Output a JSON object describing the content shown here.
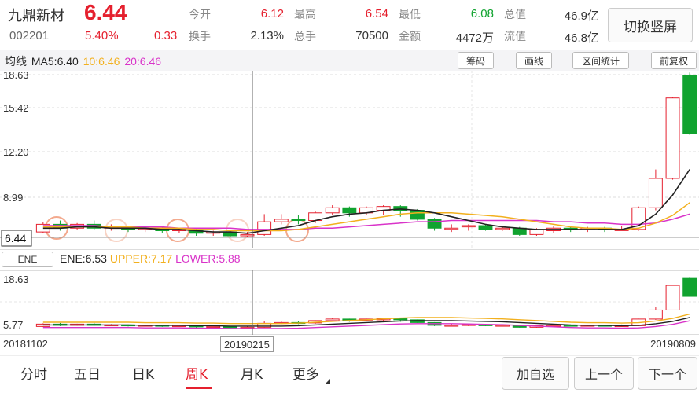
{
  "header": {
    "name": "九鼎新材",
    "price": "6.44",
    "code": "002201",
    "pct": "5.40%",
    "change": "0.33",
    "switch_label": "切换竖屏",
    "quotes": [
      {
        "label": "今开",
        "value": "6.12",
        "color": "red"
      },
      {
        "label": "最高",
        "value": "6.54",
        "color": "red"
      },
      {
        "label": "最低",
        "value": "6.08",
        "color": "green"
      },
      {
        "label": "总值",
        "value": "46.9亿",
        "color": "dark"
      },
      {
        "label": "换手",
        "value": "2.13%",
        "color": "dark"
      },
      {
        "label": "总手",
        "value": "70500",
        "color": "dark"
      },
      {
        "label": "金额",
        "value": "4472万",
        "color": "dark"
      },
      {
        "label": "流值",
        "value": "46.8亿",
        "color": "dark"
      }
    ]
  },
  "ma": {
    "label": "均线",
    "ma5": "MA5:6.40",
    "ma10": "10:6.46",
    "ma20": "20:6.46"
  },
  "tools": {
    "chips": "筹码",
    "draw": "画线",
    "range": "区间统计",
    "fq": "前复权"
  },
  "chart_data": {
    "type": "candlestick",
    "y_ticks": [
      "18.63",
      "15.42",
      "12.20",
      "8.99"
    ],
    "current_price_label": "6.44",
    "ylim": [
      5.77,
      18.63
    ],
    "candles": [
      {
        "o": 6.3,
        "c": 6.9,
        "h": 7.1,
        "l": 6.2
      },
      {
        "o": 6.9,
        "c": 6.6,
        "h": 7.2,
        "l": 6.4
      },
      {
        "o": 6.6,
        "c": 6.9,
        "h": 7.0,
        "l": 6.5
      },
      {
        "o": 6.9,
        "c": 6.6,
        "h": 7.2,
        "l": 6.5
      },
      {
        "o": 6.6,
        "c": 6.7,
        "h": 6.9,
        "l": 6.4
      },
      {
        "o": 6.7,
        "c": 6.5,
        "h": 6.8,
        "l": 6.3
      },
      {
        "o": 6.5,
        "c": 6.6,
        "h": 6.7,
        "l": 6.3
      },
      {
        "o": 6.6,
        "c": 6.4,
        "h": 6.7,
        "l": 6.2
      },
      {
        "o": 6.4,
        "c": 6.5,
        "h": 6.6,
        "l": 6.2
      },
      {
        "o": 6.5,
        "c": 6.2,
        "h": 6.6,
        "l": 6.0
      },
      {
        "o": 6.2,
        "c": 6.3,
        "h": 6.4,
        "l": 6.0
      },
      {
        "o": 6.3,
        "c": 6.0,
        "h": 6.4,
        "l": 5.9
      },
      {
        "o": 6.0,
        "c": 6.1,
        "h": 6.3,
        "l": 5.9
      },
      {
        "o": 6.1,
        "c": 7.1,
        "h": 7.7,
        "l": 6.0
      },
      {
        "o": 7.1,
        "c": 7.3,
        "h": 7.7,
        "l": 6.9
      },
      {
        "o": 7.3,
        "c": 7.2,
        "h": 7.6,
        "l": 6.9
      },
      {
        "o": 7.2,
        "c": 7.8,
        "h": 7.9,
        "l": 7.0
      },
      {
        "o": 7.8,
        "c": 8.2,
        "h": 8.4,
        "l": 7.6
      },
      {
        "o": 8.2,
        "c": 7.8,
        "h": 8.3,
        "l": 7.5
      },
      {
        "o": 7.8,
        "c": 8.2,
        "h": 8.3,
        "l": 7.6
      },
      {
        "o": 8.0,
        "c": 8.3,
        "h": 8.4,
        "l": 7.6
      },
      {
        "o": 8.3,
        "c": 8.0,
        "h": 8.4,
        "l": 7.5
      },
      {
        "o": 8.0,
        "c": 7.3,
        "h": 8.1,
        "l": 7.2
      },
      {
        "o": 7.3,
        "c": 6.6,
        "h": 7.4,
        "l": 6.4
      },
      {
        "o": 6.6,
        "c": 6.6,
        "h": 6.9,
        "l": 6.3
      },
      {
        "o": 6.7,
        "c": 6.8,
        "h": 6.9,
        "l": 6.4
      },
      {
        "o": 6.8,
        "c": 6.5,
        "h": 6.9,
        "l": 6.4
      },
      {
        "o": 6.5,
        "c": 6.6,
        "h": 6.7,
        "l": 6.4
      },
      {
        "o": 6.6,
        "c": 6.1,
        "h": 6.7,
        "l": 6.0
      },
      {
        "o": 6.1,
        "c": 6.5,
        "h": 6.6,
        "l": 6.0
      },
      {
        "o": 6.4,
        "c": 6.6,
        "h": 6.8,
        "l": 6.2
      },
      {
        "o": 6.6,
        "c": 6.5,
        "h": 6.8,
        "l": 6.3
      },
      {
        "o": 6.5,
        "c": 6.6,
        "h": 6.7,
        "l": 6.3
      },
      {
        "o": 6.6,
        "c": 6.5,
        "h": 6.7,
        "l": 6.3
      },
      {
        "o": 6.5,
        "c": 6.5,
        "h": 6.8,
        "l": 6.4
      },
      {
        "o": 6.5,
        "c": 8.2,
        "h": 8.3,
        "l": 6.4
      },
      {
        "o": 8.2,
        "c": 10.5,
        "h": 11.2,
        "l": 8.0
      },
      {
        "o": 10.5,
        "c": 16.8,
        "h": 16.9,
        "l": 10.4
      },
      {
        "o": 18.6,
        "c": 14.0,
        "h": 18.8,
        "l": 13.9
      }
    ],
    "ma5": [
      6.6,
      6.6,
      6.7,
      6.7,
      6.6,
      6.6,
      6.6,
      6.5,
      6.5,
      6.4,
      6.3,
      6.3,
      6.2,
      6.4,
      6.6,
      6.8,
      7.2,
      7.5,
      7.7,
      7.8,
      8.0,
      8.1,
      8.0,
      7.8,
      7.5,
      7.2,
      6.9,
      6.7,
      6.6,
      6.5,
      6.5,
      6.5,
      6.5,
      6.5,
      6.5,
      6.8,
      7.7,
      9.2,
      11.2
    ],
    "ma10": [
      6.7,
      6.7,
      6.7,
      6.7,
      6.7,
      6.7,
      6.6,
      6.6,
      6.6,
      6.5,
      6.5,
      6.4,
      6.4,
      6.4,
      6.4,
      6.5,
      6.7,
      6.9,
      7.1,
      7.3,
      7.5,
      7.7,
      7.8,
      7.8,
      7.8,
      7.7,
      7.6,
      7.5,
      7.3,
      7.1,
      6.9,
      6.7,
      6.6,
      6.6,
      6.5,
      6.6,
      7.0,
      7.6,
      8.6
    ],
    "ma20": [
      6.8,
      6.8,
      6.8,
      6.8,
      6.7,
      6.7,
      6.7,
      6.7,
      6.6,
      6.6,
      6.6,
      6.6,
      6.5,
      6.5,
      6.5,
      6.5,
      6.6,
      6.6,
      6.7,
      6.8,
      6.9,
      7.0,
      7.1,
      7.1,
      7.2,
      7.2,
      7.2,
      7.2,
      7.2,
      7.2,
      7.1,
      7.1,
      7.0,
      7.0,
      6.9,
      6.9,
      7.0,
      7.3,
      7.7
    ]
  },
  "ene": {
    "button": "ENE",
    "ene": "ENE:6.53",
    "upper": "UPPER:7.17",
    "lower": "LOWER:5.88",
    "y_top": "18.63",
    "y_bottom": "5.77"
  },
  "dates": {
    "start": "20181102",
    "cursor": "20190215",
    "end": "20190809"
  },
  "tabs": {
    "items": [
      "分时",
      "五日",
      "日K",
      "周K",
      "月K",
      "更多"
    ],
    "active": "周K"
  },
  "nav": {
    "add": "加自选",
    "prev": "上一个",
    "next": "下一个"
  },
  "colors": {
    "up": "#e5202e",
    "down": "#10a32f",
    "ma5": "#222222",
    "ma10": "#f2b01e",
    "ma20": "#d933c9"
  }
}
